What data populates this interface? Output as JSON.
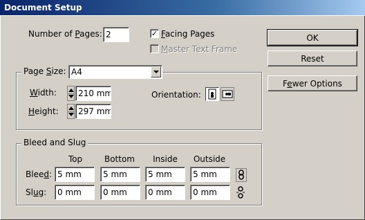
{
  "window": {
    "title": "Document Setup"
  },
  "pages": {
    "label_prefix": "Number of ",
    "label_key": "P",
    "label_suffix": "ages:",
    "value": "2"
  },
  "facing_pages": {
    "checked": true,
    "label_key": "F",
    "label_rest": "acing Pages"
  },
  "master_text_frame": {
    "checked": false,
    "disabled": true,
    "label_key": "M",
    "label_rest": "aster Text Frame"
  },
  "buttons": {
    "ok": "OK",
    "reset": "Reset",
    "fewer_prefix": "F",
    "fewer_key": "e",
    "fewer_suffix": "wer Options"
  },
  "page_size": {
    "label_prefix": "Page ",
    "label_key": "S",
    "label_suffix": "ize:",
    "value": "A4",
    "width_key": "W",
    "width_rest": "idth:",
    "width_value": "210 mm",
    "height_key": "H",
    "height_rest": "eight:",
    "height_value": "297 mm",
    "orientation_label": "Orientation:",
    "orientation_selected": "portrait"
  },
  "bleed_slug": {
    "group_label": "Bleed and Slug",
    "columns": [
      "Top",
      "Bottom",
      "Inside",
      "Outside"
    ],
    "bleed_label_prefix": "Blee",
    "bleed_label_key": "d",
    "bleed_label_suffix": ":",
    "bleed_values": [
      "5 mm",
      "5 mm",
      "5 mm",
      "5 mm"
    ],
    "slug_label_prefix": "Sl",
    "slug_label_key": "u",
    "slug_label_suffix": "g:",
    "slug_values": [
      "0 mm",
      "0 mm",
      "0 mm",
      "0 mm"
    ]
  },
  "icons": {
    "portrait": "portrait-orientation-icon",
    "landscape": "landscape-orientation-icon",
    "bleed_link": "chain-link-icon",
    "slug_link": "broken-chain-link-icon"
  }
}
